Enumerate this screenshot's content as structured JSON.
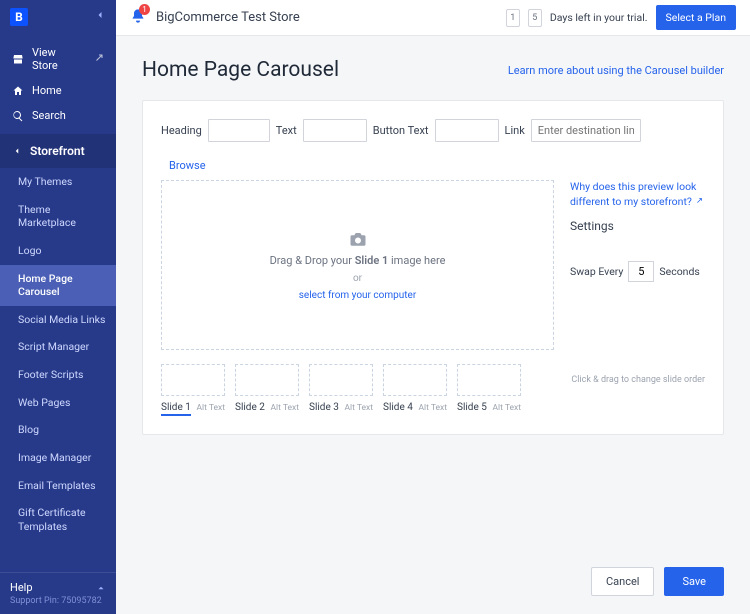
{
  "logo_letter": "B",
  "nav": {
    "view_store": "View Store",
    "home": "Home",
    "search": "Search"
  },
  "storefront": {
    "label": "Storefront",
    "items": [
      "My Themes",
      "Theme Marketplace",
      "Logo",
      "Home Page Carousel",
      "Social Media Links",
      "Script Manager",
      "Footer Scripts",
      "Web Pages",
      "Blog",
      "Image Manager",
      "Email Templates",
      "Gift Certificate Templates"
    ]
  },
  "help": {
    "title": "Help",
    "pin_label": "Support Pin:",
    "pin": "75095782"
  },
  "topbar": {
    "notification_count": "1",
    "store_name": "BigCommerce Test Store",
    "trial_d1": "1",
    "trial_d2": "5",
    "trial_text": "Days left in your trial.",
    "select_plan": "Select a Plan"
  },
  "page": {
    "title": "Home Page Carousel",
    "learn_more": "Learn more about using the Carousel builder"
  },
  "form": {
    "heading_label": "Heading",
    "text_label": "Text",
    "button_text_label": "Button Text",
    "link_label": "Link",
    "link_placeholder": "Enter destination link",
    "browse": "Browse",
    "drop_pre": "Drag & Drop your ",
    "drop_bold": "Slide 1",
    "drop_post": " image here",
    "or": "or",
    "select_computer": "select from your computer",
    "why_preview": "Why does this preview look different to my storefront?",
    "settings_hd": "Settings",
    "swap_every": "Swap Every",
    "swap_value": "5",
    "seconds": "Seconds",
    "drag_hint": "Click & drag to change slide order"
  },
  "slides": [
    {
      "label": "Slide 1",
      "alt": "Alt Text",
      "active": true
    },
    {
      "label": "Slide 2",
      "alt": "Alt Text",
      "active": false
    },
    {
      "label": "Slide 3",
      "alt": "Alt Text",
      "active": false
    },
    {
      "label": "Slide 4",
      "alt": "Alt Text",
      "active": false
    },
    {
      "label": "Slide 5",
      "alt": "Alt Text",
      "active": false
    }
  ],
  "footer": {
    "cancel": "Cancel",
    "save": "Save"
  }
}
